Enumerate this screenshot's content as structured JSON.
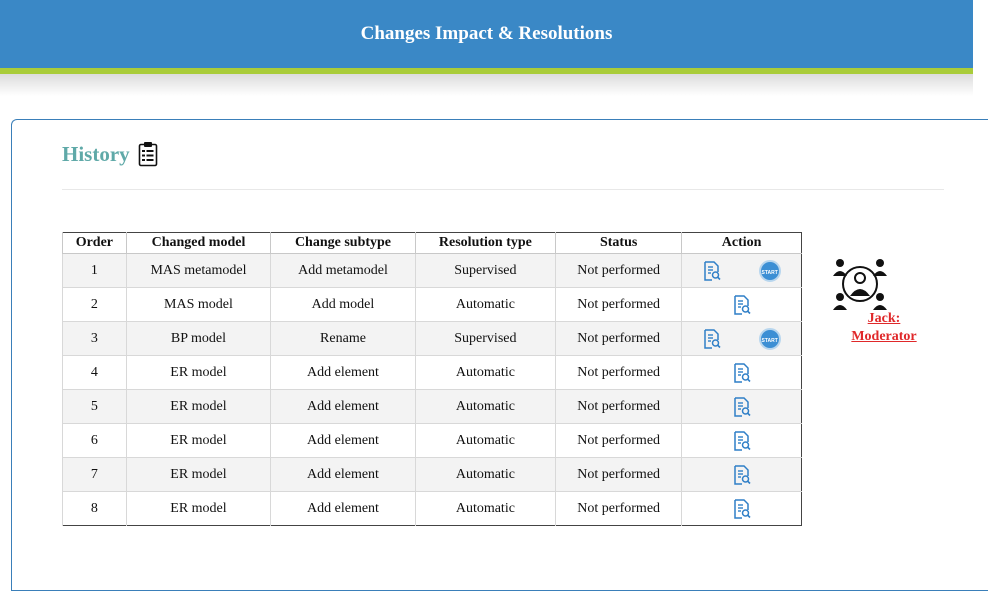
{
  "header": {
    "title": "Changes Impact & Resolutions"
  },
  "history": {
    "title": "History",
    "columns": [
      "Order",
      "Changed model",
      "Change subtype",
      "Resolution type",
      "Status",
      "Action"
    ],
    "rows": [
      {
        "order": "1",
        "model": "MAS metamodel",
        "subtype": "Add metamodel",
        "resolution": "Supervised",
        "status": "Not performed",
        "start": true
      },
      {
        "order": "2",
        "model": "MAS model",
        "subtype": "Add model",
        "resolution": "Automatic",
        "status": "Not performed",
        "start": false
      },
      {
        "order": "3",
        "model": "BP model",
        "subtype": "Rename",
        "resolution": "Supervised",
        "status": "Not performed",
        "start": true
      },
      {
        "order": "4",
        "model": "ER model",
        "subtype": "Add element",
        "resolution": "Automatic",
        "status": "Not performed",
        "start": false
      },
      {
        "order": "5",
        "model": "ER model",
        "subtype": "Add element",
        "resolution": "Automatic",
        "status": "Not performed",
        "start": false
      },
      {
        "order": "6",
        "model": "ER model",
        "subtype": "Add element",
        "resolution": "Automatic",
        "status": "Not performed",
        "start": false
      },
      {
        "order": "7",
        "model": "ER model",
        "subtype": "Add element",
        "resolution": "Automatic",
        "status": "Not performed",
        "start": false
      },
      {
        "order": "8",
        "model": "ER model",
        "subtype": "Add element",
        "resolution": "Automatic",
        "status": "Not performed",
        "start": false
      }
    ],
    "start_label": "START"
  },
  "user": {
    "name": "Jack:",
    "role": "Moderator"
  },
  "icons": {
    "history": "clipboard-icon",
    "view": "document-search-icon",
    "start": "start-button-icon",
    "user": "moderator-group-icon"
  },
  "colors": {
    "banner": "#3a88c6",
    "banner_stripe": "#a9cc3a",
    "title": "#5fa9a8",
    "user_link": "#e0282a",
    "start": "#3c8fd4"
  }
}
